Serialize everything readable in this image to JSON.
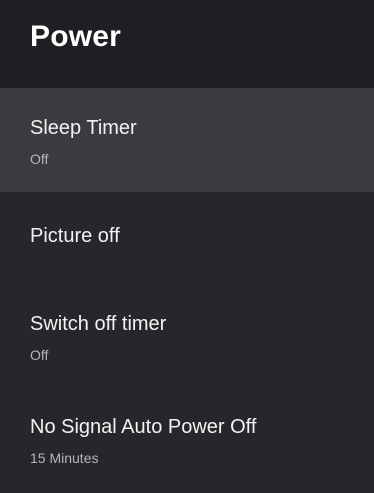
{
  "header": {
    "title": "Power"
  },
  "menu": {
    "items": [
      {
        "label": "Sleep Timer",
        "value": "Off",
        "focused": true
      },
      {
        "label": "Picture off",
        "value": ""
      },
      {
        "label": "Switch off timer",
        "value": "Off"
      },
      {
        "label": "No Signal Auto Power Off",
        "value": "15 Minutes"
      }
    ]
  },
  "colors": {
    "background": "#26272b",
    "header_background": "#1e1f22",
    "focused_item_background": "#3a3b3f",
    "primary_text": "#f2f2f2",
    "secondary_text": "#b5b5b5"
  }
}
